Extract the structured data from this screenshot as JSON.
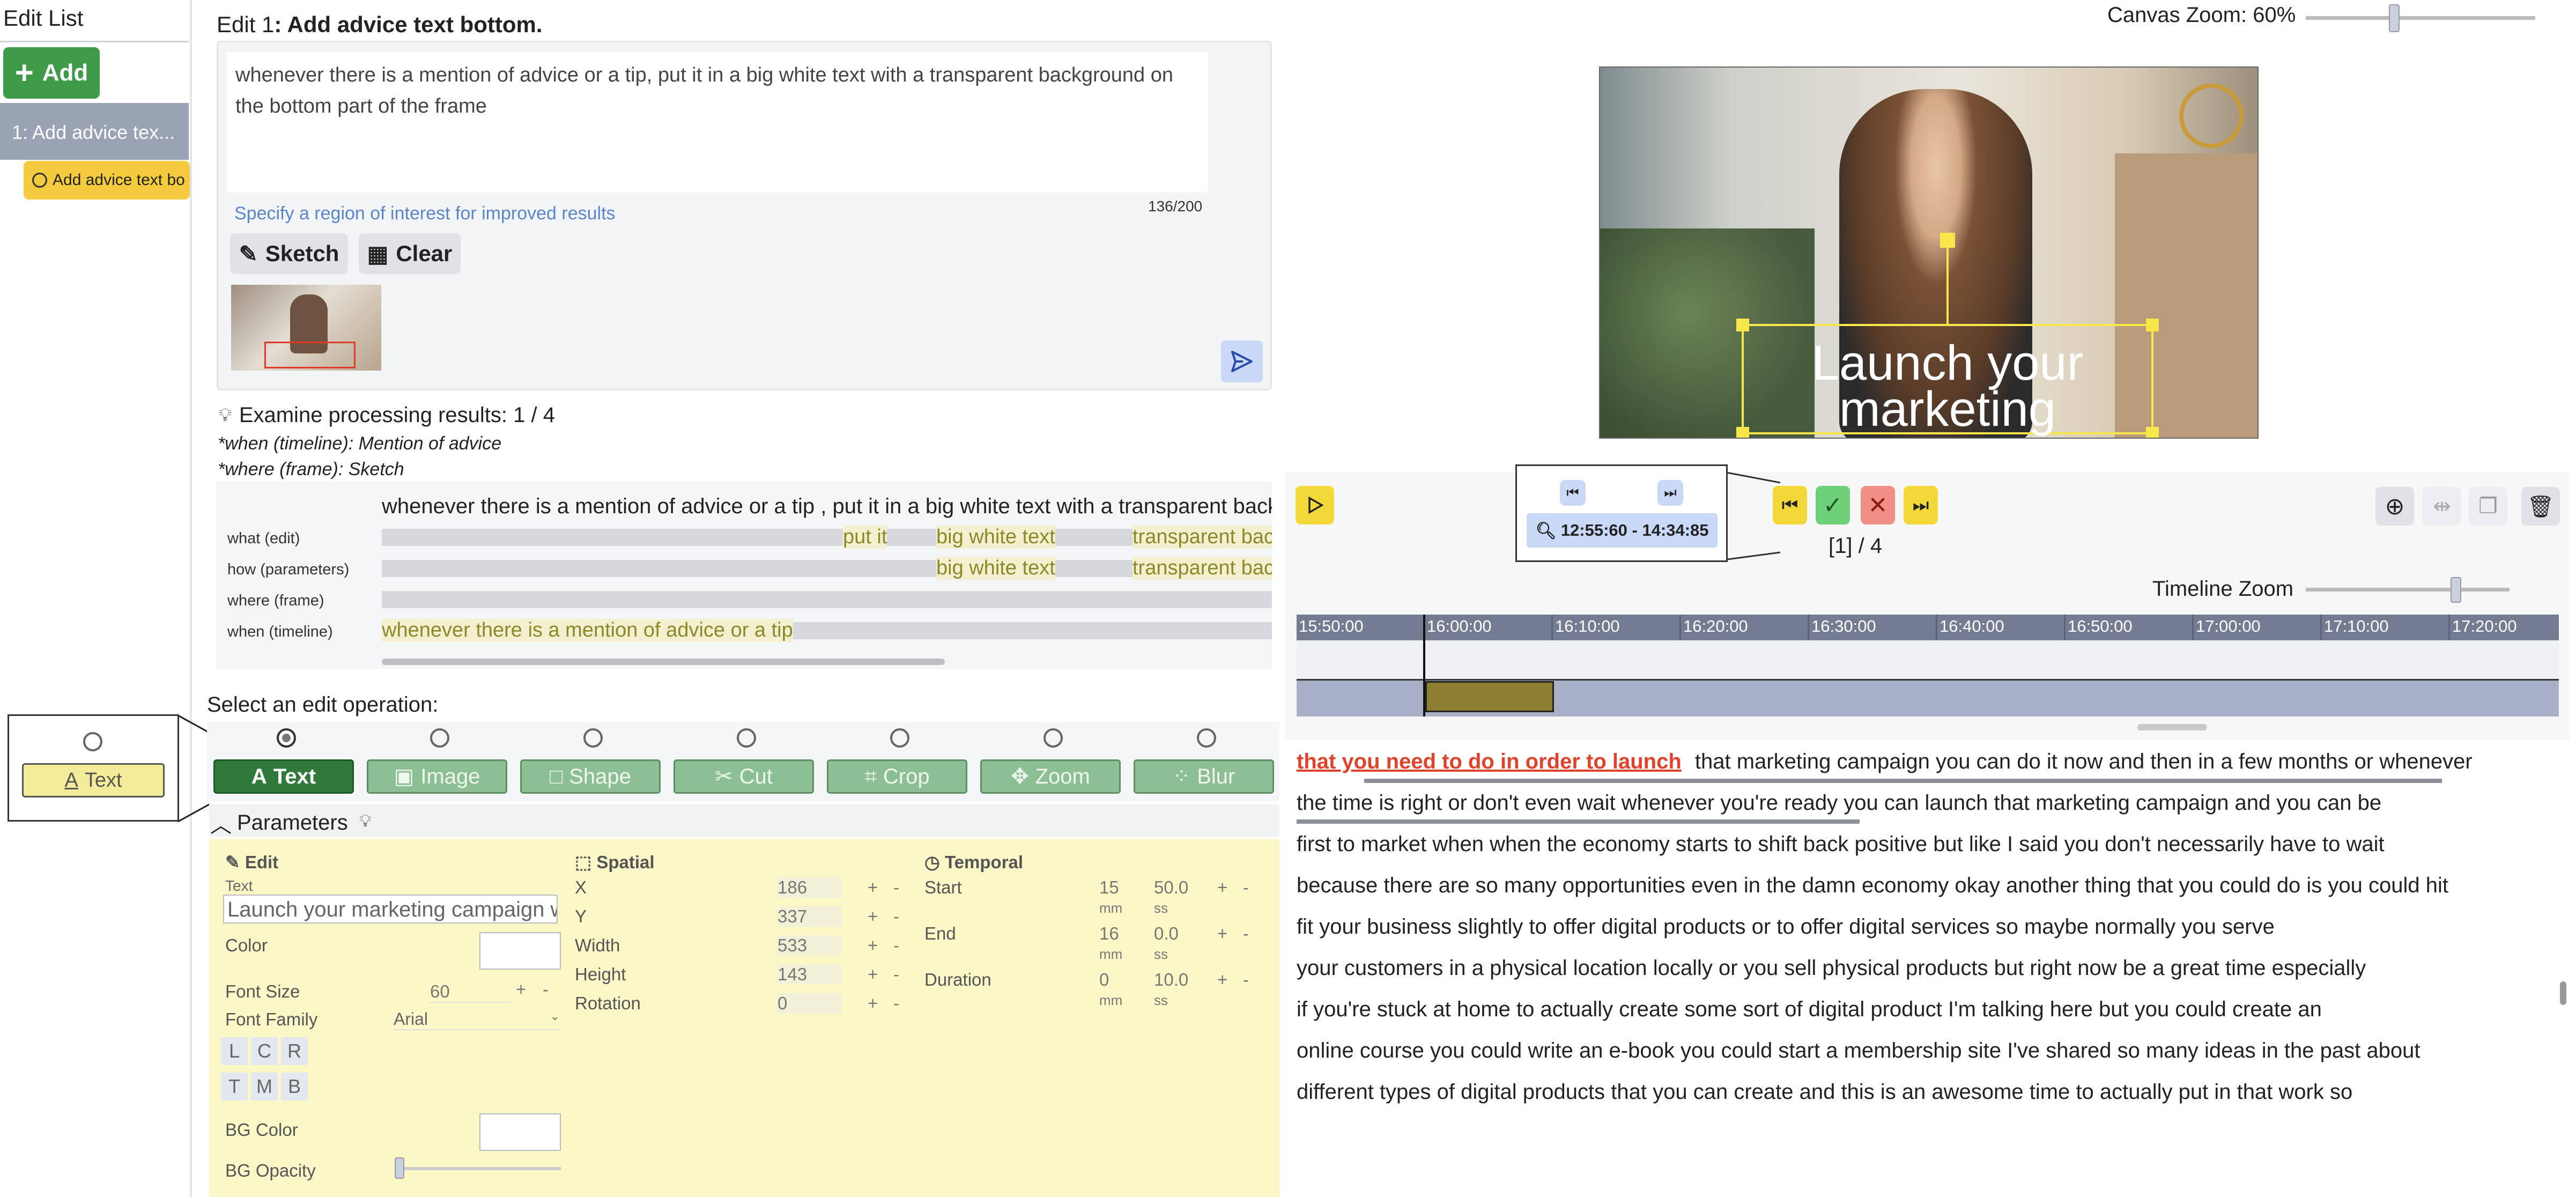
{
  "sidebar": {
    "title": "Edit List",
    "add_label": "Add",
    "items": [
      {
        "label": "1: Add advice tex..."
      }
    ],
    "tag_label": "Add advice text bo"
  },
  "edit": {
    "header_prefix": "Edit 1",
    "header_title": ": Add advice text bottom.",
    "description": "whenever there is a mention of advice or a tip, put it in a big white text with a transparent background on the bottom part of the frame",
    "char_count": "136/200",
    "hint": "Specify a region of interest for improved results",
    "sketch_label": "Sketch",
    "clear_label": "Clear"
  },
  "results": {
    "title": "Examine processing results: 1 / 4",
    "when_line": "*when (timeline): Mention of advice",
    "where_line": "*where (frame): Sketch",
    "sentence": "whenever there is a mention of advice or a tip , put it in a big white text with a transparent background",
    "rows": [
      {
        "label": "what (edit)"
      },
      {
        "label": "how (parameters)"
      },
      {
        "label": "where (frame)"
      },
      {
        "label": "when (timeline)"
      }
    ],
    "hl_put_it": "put it",
    "hl_big_white": "big white text",
    "hl_transparent": "transparent background",
    "hl_when": "whenever there is a mention of advice or a tip"
  },
  "operations": {
    "prompt": "Select an edit operation:",
    "items": [
      "Text",
      "Image",
      "Shape",
      "Cut",
      "Crop",
      "Zoom",
      "Blur"
    ],
    "selected": "Text",
    "preview_label": "Text"
  },
  "parameters": {
    "title": "Parameters",
    "edit": {
      "header": "Edit",
      "text_label": "Text",
      "text_value": "Launch your marketing campaign with",
      "color_label": "Color",
      "font_size_label": "Font Size",
      "font_size_value": "60",
      "font_family_label": "Font Family",
      "font_family_value": "Arial",
      "align_h": [
        "L",
        "C",
        "R"
      ],
      "align_v": [
        "T",
        "M",
        "B"
      ],
      "bg_color_label": "BG Color",
      "bg_opacity_label": "BG Opacity"
    },
    "spatial": {
      "header": "Spatial",
      "fields": [
        {
          "label": "X",
          "value": "186"
        },
        {
          "label": "Y",
          "value": "337"
        },
        {
          "label": "Width",
          "value": "533"
        },
        {
          "label": "Height",
          "value": "143"
        },
        {
          "label": "Rotation",
          "value": "0"
        }
      ]
    },
    "temporal": {
      "header": "Temporal",
      "fields": [
        {
          "label": "Start",
          "mm": "15",
          "ss": "50.0"
        },
        {
          "label": "End",
          "mm": "16",
          "ss": "0.0"
        },
        {
          "label": "Duration",
          "mm": "0",
          "ss": "10.0"
        }
      ],
      "unit_mm": "mm",
      "unit_ss": "ss"
    },
    "plus": "+",
    "minus": "-"
  },
  "canvas": {
    "zoom_label": "Canvas Zoom: 60%",
    "overlay_text": "Launch your marketing",
    "zoom_fraction": 0.38
  },
  "player": {
    "range_label": "12:55:60 - 14:34:85",
    "segment_label": "[1] / 4",
    "timeline_zoom_label": "Timeline Zoom",
    "timeline_zoom_fraction": 0.75,
    "ticks": [
      "15:50:00",
      "16:00:00",
      "16:10:00",
      "16:20:00",
      "16:30:00",
      "16:40:00",
      "16:50:00",
      "17:00:00",
      "17:10:00",
      "17:20:00"
    ]
  },
  "transcript": {
    "highlight": "that you need to do in order to launch",
    "lines": [
      "that marketing campaign you can do it  now and then in a few months or whenever",
      "the time is right or don't even wait  whenever you're ready you can launch  that marketing campaign and you can be",
      "first to market when when the economy  starts to shift back positive but like I  said you don't necessarily have to wait",
      "because there are so many opportunities  even in the damn economy okay another  thing that you could do is you could hit",
      "fit your business slightly to offer  digital products or to offer digital  services so maybe normally you serve",
      "your customers in a physical location  locally or you sell physical products  but right now be a great time especially",
      "if you're stuck at home to actually  create some sort of digital product I'm  talking here but you could create an",
      "online course you could write an e-book  you could start a membership site I've  shared so many ideas in the past about",
      "different types of digital products that  you can create and this is an awesome  time to actually put in that work so"
    ]
  },
  "colors": {
    "green": "#3f9b4a",
    "yellow": "#f3cb3c",
    "red_highlight": "#e0432a",
    "timeline_bar": "#747c92",
    "segment": "#8c7f32"
  }
}
